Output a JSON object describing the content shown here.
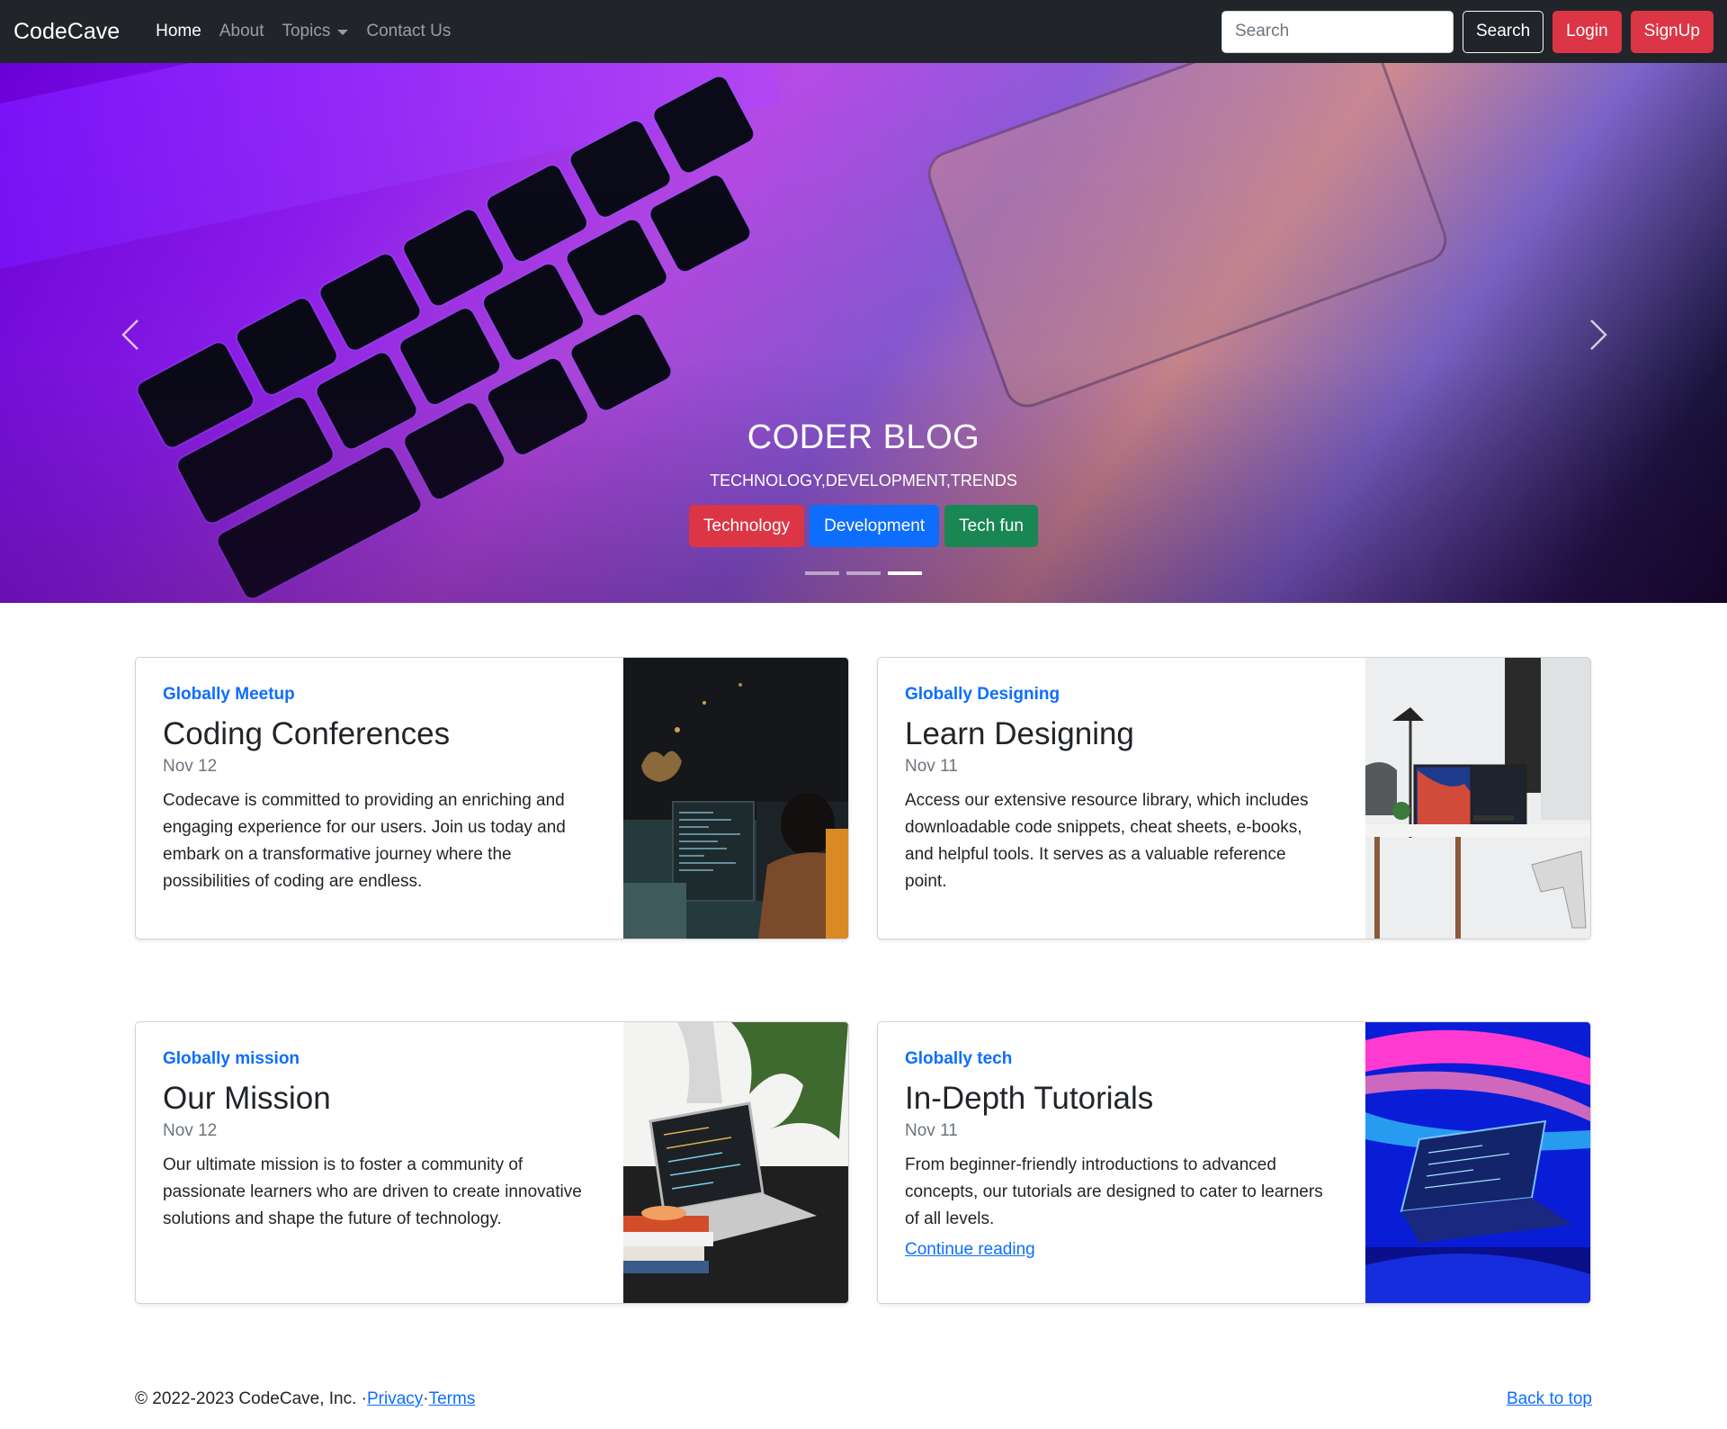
{
  "navbar": {
    "brand": "CodeCave",
    "links": [
      {
        "label": "Home"
      },
      {
        "label": "About"
      },
      {
        "label": "Topics"
      },
      {
        "label": "Contact Us"
      }
    ],
    "search_placeholder": "Search",
    "search_button": "Search",
    "login_button": "Login",
    "signup_button": "SignUp"
  },
  "hero": {
    "title": "CODER BLOG",
    "subtitle": "TECHNOLOGY,DEVELOPMENT,TRENDS",
    "buttons": [
      {
        "label": "Technology",
        "color": "#dc3545"
      },
      {
        "label": "Development",
        "color": "#0d6efd"
      },
      {
        "label": "Tech fun",
        "color": "#198754"
      }
    ],
    "active_slide": 3,
    "slide_count": 3,
    "prev_icon": "chevron-left-icon",
    "next_icon": "chevron-right-icon"
  },
  "cards": [
    {
      "tag": "Globally Meetup",
      "title": "Coding Conferences",
      "date": "Nov 12",
      "text": "Codecave is committed to providing an enriching and engaging experience for our users. Join us today and embark on a transformative journey where the possibilities of coding are endless."
    },
    {
      "tag": "Globally Designing",
      "title": "Learn Designing",
      "date": "Nov 11",
      "text": "Access our extensive resource library, which includes downloadable code snippets, cheat sheets, e-books, and helpful tools. It serves as a valuable reference point."
    },
    {
      "tag": "Globally mission",
      "title": "Our Mission",
      "date": "Nov 12",
      "text": "Our ultimate mission is to foster a community of passionate learners who are driven to create innovative solutions and shape the future of technology."
    },
    {
      "tag": "Globally tech",
      "title": "In-Depth Tutorials",
      "date": "Nov 11",
      "text": "From beginner-friendly introductions to advanced concepts, our tutorials are designed to cater to learners of all levels.",
      "link": "Continue reading"
    }
  ],
  "footer": {
    "copyright": "© 2022-2023 CodeCave, Inc. · ",
    "privacy": "Privacy",
    "separator": " · ",
    "terms": "Terms",
    "back_to_top": "Back to top"
  },
  "colors": {
    "navbar_bg": "#212529",
    "accent_blue": "#0d6efd",
    "danger": "#dc3545",
    "success": "#198754"
  }
}
